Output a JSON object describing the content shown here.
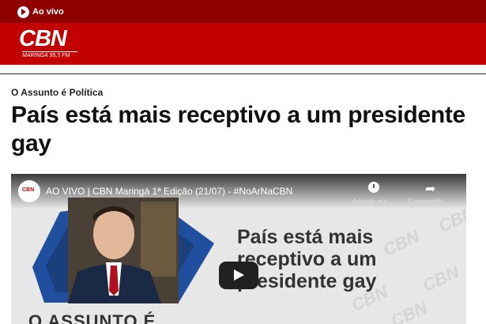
{
  "topbar": {
    "live_label": "Ao vivo"
  },
  "brand": {
    "logo_text": "CBN",
    "logo_subtext": "MARINGÁ 95,5 FM"
  },
  "article": {
    "kicker": "O Assunto é Política",
    "headline": "País está mais receptivo a um presidente gay"
  },
  "video": {
    "title": "AO VIVO | CBN Maringá 1ª Edição (21/07) - #NoArNaCBN",
    "watch_later_label": "Assistir ma...",
    "share_label": "Compartilh...",
    "overlay_lines": [
      "País está mais",
      "receptivo a um",
      "presidente gay"
    ],
    "lower_text": "O ASSUNTO É",
    "watermark": "CBN"
  },
  "colors": {
    "topbar": "#8f0000",
    "brand": "#c20000"
  }
}
